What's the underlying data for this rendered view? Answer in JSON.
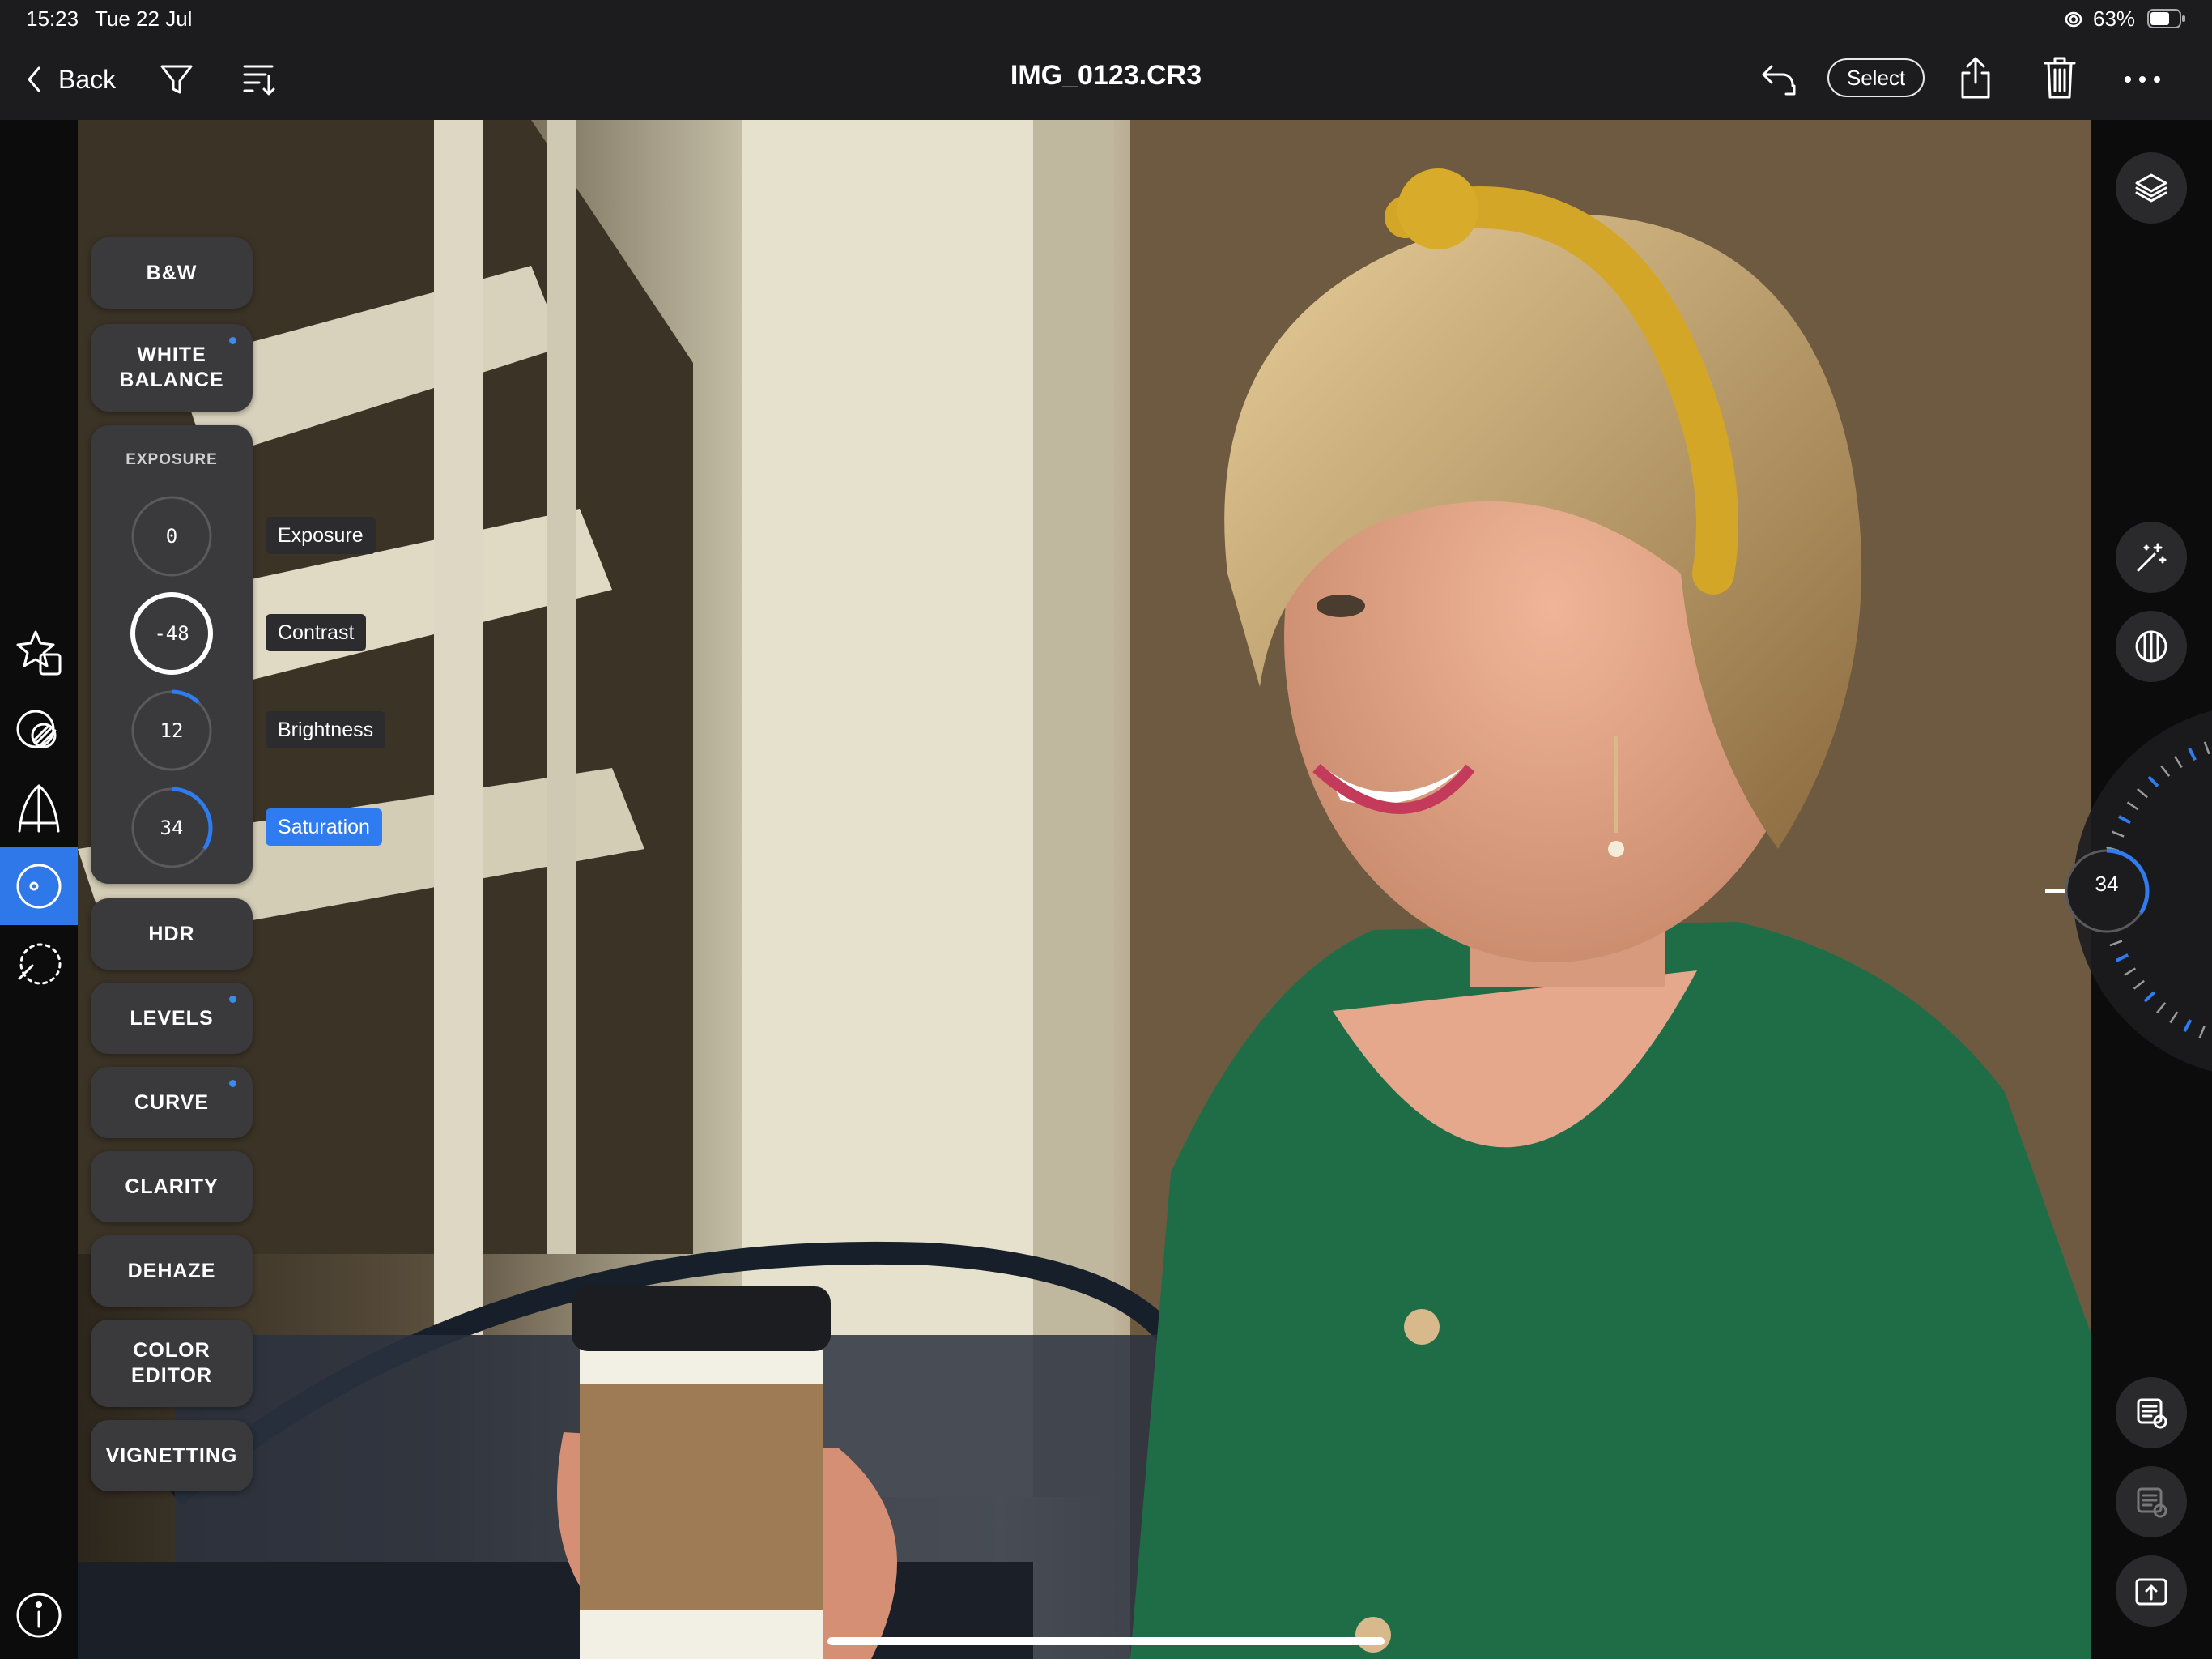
{
  "status_bar": {
    "time": "15:23",
    "date": "Tue 22 Jul",
    "battery": "63%"
  },
  "nav": {
    "back_label": "Back",
    "title": "IMG_0123.CR3",
    "select_label": "Select"
  },
  "tools": {
    "bw": "B&W",
    "white_balance": "WHITE BALANCE",
    "exposure_heading": "EXPOSURE",
    "hdr": "HDR",
    "levels": "LEVELS",
    "curve": "CURVE",
    "clarity": "CLARITY",
    "dehaze": "DEHAZE",
    "color_editor": "COLOR EDITOR",
    "vignetting": "VIGNETTING"
  },
  "exposure_sliders": [
    {
      "label": "Exposure",
      "value": "0",
      "amount": 0
    },
    {
      "label": "Contrast",
      "value": "-48",
      "amount": -48
    },
    {
      "label": "Brightness",
      "value": "12",
      "amount": 12
    },
    {
      "label": "Saturation",
      "value": "34",
      "amount": 34
    }
  ],
  "active_slider": "Saturation",
  "dial": {
    "value": "34",
    "amount": 34
  },
  "colors": {
    "accent": "#2f7bf0",
    "panel": "#3a3a3c",
    "bar": "#1c1c1e"
  },
  "icons": [
    "back-chevron-icon",
    "filter-icon",
    "sort-icon",
    "undo-icon",
    "share-icon",
    "trash-icon",
    "more-icon",
    "layers-icon",
    "magic-wand-icon",
    "mask-icon",
    "presets-icon",
    "crop-icon",
    "adjust-icon",
    "retouch-icon",
    "info-icon"
  ]
}
